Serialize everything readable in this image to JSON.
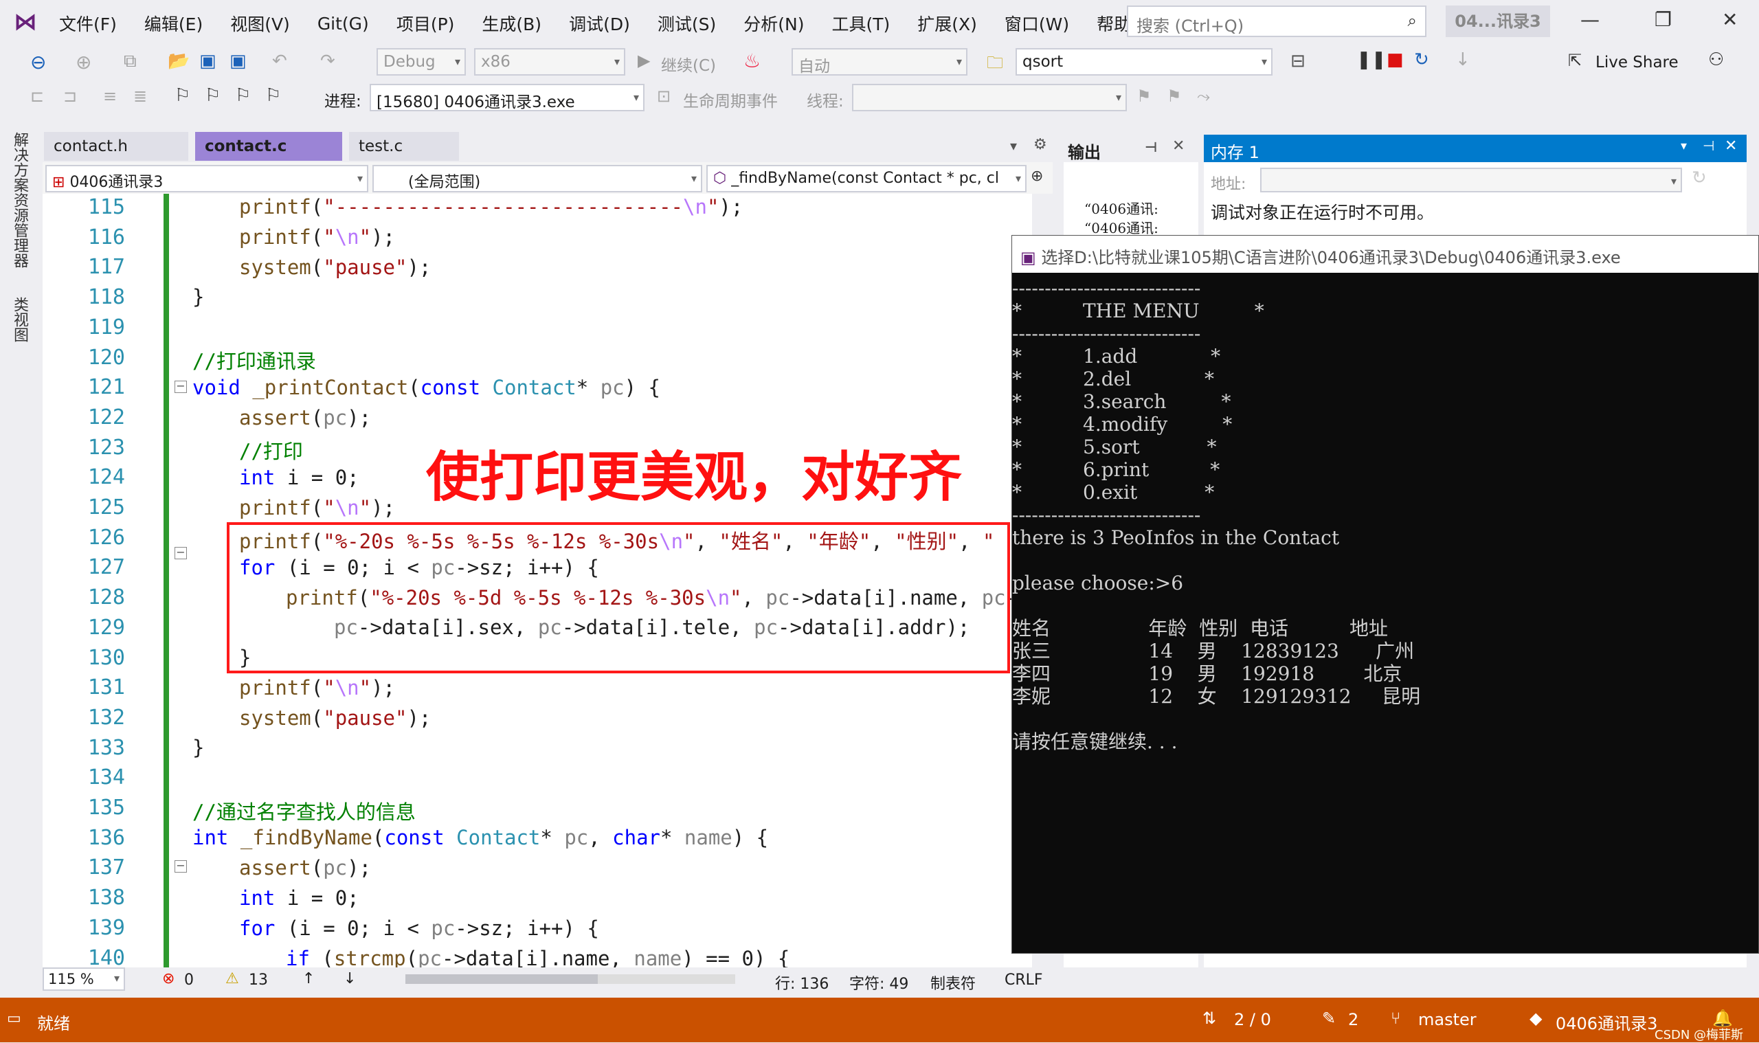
{
  "menu": [
    "文件(F)",
    "编辑(E)",
    "视图(V)",
    "Git(G)",
    "项目(P)",
    "生成(B)",
    "调试(D)",
    "测试(S)",
    "分析(N)",
    "工具(T)",
    "扩展(X)",
    "窗口(W)",
    "帮助(H)"
  ],
  "search_placeholder": "搜索 (Ctrl+Q)",
  "project_title": "04...讯录3",
  "toolbar": {
    "config": "Debug",
    "platform": "x86",
    "continue": "继续(C)",
    "auto": "自动",
    "find": "qsort",
    "live_share": "Live Share",
    "process_label": "进程:",
    "process": "[15680] 0406通讯录3.exe",
    "lifecycle": "生命周期事件",
    "thread_label": "线程:"
  },
  "sidebar": [
    "解决方案资源管理器",
    "类视图"
  ],
  "tabs": [
    "contact.h",
    "contact.c",
    "test.c"
  ],
  "nav": {
    "project": "0406通讯录3",
    "scope": "(全局范围)",
    "func": "_findByName(const Contact * pc, cl"
  },
  "line_numbers": [
    "115",
    "116",
    "117",
    "118",
    "119",
    "120",
    "121",
    "122",
    "123",
    "124",
    "125",
    "126",
    "127",
    "128",
    "129",
    "130",
    "131",
    "132",
    "133",
    "134",
    "135",
    "136",
    "137",
    "138",
    "139",
    "140"
  ],
  "annotation": "使打印更美观，对好齐",
  "output": {
    "title": "输出",
    "lines": [
      "“0406通讯:",
      "“0406通讯:"
    ]
  },
  "memory": {
    "title": "内存 1",
    "addr_label": "地址:",
    "msg": "调试对象正在运行时不可用。"
  },
  "console": {
    "title": "选择D:\\比特就业课105期\\C语言进阶\\0406通讯录3\\Debug\\0406通讯录3.exe",
    "lines": [
      "-----------------------------",
      "*          THE MENU         *",
      "-----------------------------",
      "*          1.add            *",
      "*          2.del            *",
      "*          3.search         *",
      "*          4.modify         *",
      "*          5.sort           *",
      "*          6.print          *",
      "*          0.exit           *",
      "-----------------------------",
      "there is 3 PeoInfos in the Contact",
      "",
      "please choose:>6",
      "",
      "姓名                年龄  性别  电话          地址",
      "张三                14    男    12839123      广州",
      "李四                19    男    192918        北京",
      "李妮                12    女    129129312     昆明",
      "",
      "请按任意键继续. . ."
    ]
  },
  "editor_status": {
    "zoom": "115 %",
    "errors": "0",
    "warnings": "13",
    "line": "行: 136",
    "char": "字符: 49",
    "tabs": "制表符",
    "eol": "CRLF"
  },
  "status": {
    "ready": "就绪",
    "sync": "2 / 0",
    "edits": "2",
    "branch": "master",
    "repo": "0406通讯录3",
    "watermark": "CSDN @梅菲斯"
  }
}
